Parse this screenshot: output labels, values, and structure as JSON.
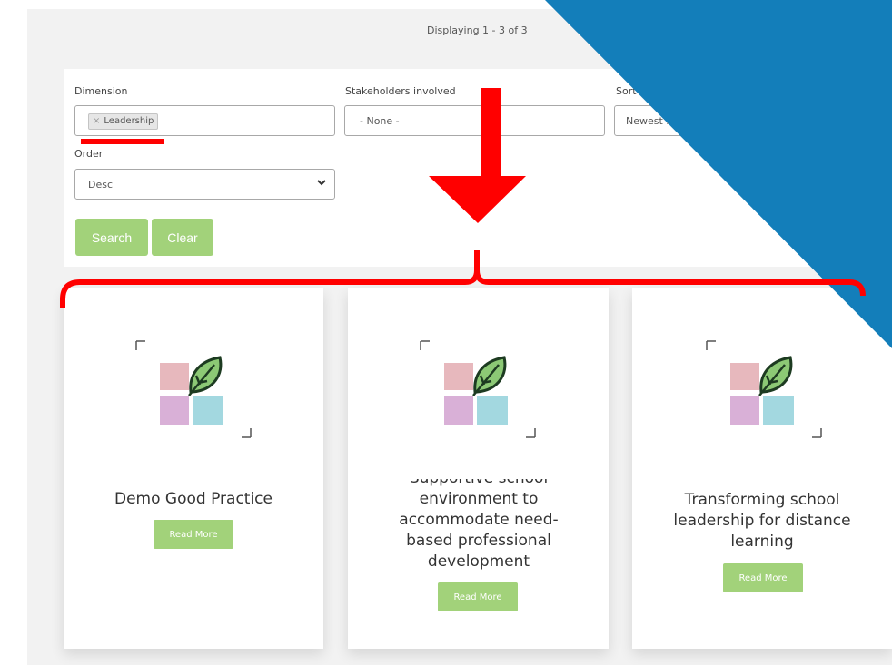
{
  "results": {
    "count_text": "Displaying 1 - 3 of 3"
  },
  "filters": {
    "dimension": {
      "label": "Dimension",
      "selected_tag": "Leadership",
      "tag_remove": "×"
    },
    "stakeholders": {
      "label": "Stakeholders involved",
      "value": "- None -"
    },
    "sort": {
      "label": "Sort by",
      "value": "Newest first"
    },
    "order": {
      "label": "Order",
      "value": "Desc"
    },
    "search_label": "Search",
    "clear_label": "Clear"
  },
  "cards": [
    {
      "title": "Demo Good Practice",
      "button": "Read More"
    },
    {
      "title": "Supportive school environment to accommodate need-based professional development",
      "button": "Read More"
    },
    {
      "title": "Transforming school leadership for distance learning",
      "button": "Read More"
    }
  ],
  "colors": {
    "accent_green": "#a2d27a",
    "annotation_red": "#ff0000",
    "corner_blue": "#137eba"
  },
  "icons": {
    "logo": "leaf-squares-logo",
    "select_caret": "chevron-down-icon",
    "annotation_arrow": "down-arrow-annotation"
  }
}
